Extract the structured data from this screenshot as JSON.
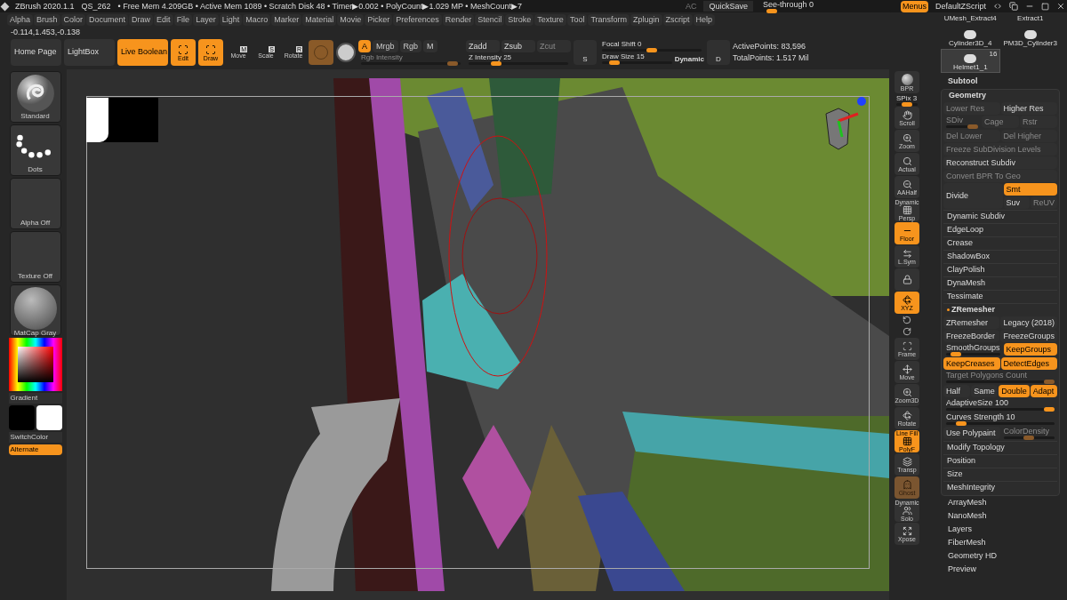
{
  "title_bar": {
    "app": "ZBrush 2020.1.1",
    "project": "QS_262",
    "status": "• Free Mem 4.209GB • Active Mem 1089 • Scratch Disk 48 • Timer▶0.002 • PolyCount▶1.029 MP • MeshCount▶7",
    "ac": "AC",
    "quicksave": "QuickSave",
    "see_through": {
      "label": "See-through  0",
      "level": 0.03
    },
    "menus": {
      "label": "Menus",
      "on": true
    },
    "script": "DefaultZScript"
  },
  "menu_bar": [
    "Alpha",
    "Brush",
    "Color",
    "Document",
    "Draw",
    "Edit",
    "File",
    "Layer",
    "Light",
    "Macro",
    "Marker",
    "Material",
    "Movie",
    "Picker",
    "Preferences",
    "Render",
    "Stencil",
    "Stroke",
    "Texture",
    "Tool",
    "Transform",
    "Zplugin",
    "Zscript",
    "Help"
  ],
  "coordinates": "-0.114,1.453,-0.138",
  "toolbar": {
    "buttons": [
      {
        "label": "Home Page",
        "on": false
      },
      {
        "label": "LightBox",
        "on": false
      },
      {
        "label": "Live Boolean",
        "on": true
      }
    ],
    "transform_modes": [
      {
        "label": "Edit",
        "on": true
      },
      {
        "label": "Draw",
        "on": true
      },
      {
        "label": "Move",
        "key": "M",
        "on": false
      },
      {
        "label": "Scale",
        "key": "S",
        "on": false
      },
      {
        "label": "Rotate",
        "key": "R",
        "on": false
      }
    ],
    "color_modes": [
      {
        "label": "A",
        "on": true
      },
      {
        "label": "Mrgb",
        "on": false
      },
      {
        "label": "Rgb",
        "on": false
      },
      {
        "label": "M",
        "on": false
      }
    ],
    "rgb_intensity": {
      "label": "Rgb Intensity",
      "level": 0.97,
      "disabled": true
    },
    "depth_modes": [
      {
        "label": "Zadd",
        "on": false,
        "disabled": false
      },
      {
        "label": "Zsub",
        "on": false,
        "disabled": false
      },
      {
        "label": "Zcut",
        "on": false,
        "disabled": true
      }
    ],
    "z_intensity": {
      "label": "Z Intensity 25",
      "level": 0.25
    },
    "focal_key": "S",
    "focal_shift": {
      "label": "Focal Shift 0",
      "level": 0.5
    },
    "draw_size": {
      "label": "Draw Size 15",
      "level": 0.12
    },
    "dynamic": "Dynamic",
    "points_key": "D",
    "active_points": "ActivePoints: 83,596",
    "total_points": "TotalPoints: 1.517 Mil"
  },
  "tools": [
    {
      "label": "UMesh_Extract4",
      "selected": false
    },
    {
      "label": "Extract1",
      "selected": false
    },
    {
      "label": "Cylinder3D_4",
      "selected": false
    },
    {
      "label": "PM3D_Cylinder3",
      "selected": false
    },
    {
      "label": "Helmet1_1",
      "count": "16",
      "selected": true
    }
  ],
  "left_shelf": {
    "tiles": [
      "Standard",
      "Dots",
      "Alpha Off",
      "Texture Off",
      "MatCap Gray"
    ],
    "gradient": "Gradient",
    "swatches": [
      {
        "color": "#000000"
      },
      {
        "color": "#ffffff"
      }
    ],
    "switch_color": "SwitchColor",
    "alternate": {
      "label": "Alternate",
      "on": true
    }
  },
  "right_toolbar": [
    {
      "kind": "button",
      "label": "BPR",
      "on": false,
      "disabled": false
    },
    {
      "kind": "slider",
      "label": "SPix 3",
      "level": 0.5
    },
    {
      "kind": "button",
      "label": "Scroll",
      "on": false,
      "disabled": false
    },
    {
      "kind": "button",
      "label": "Zoom",
      "on": false,
      "disabled": false
    },
    {
      "kind": "button",
      "label": "Actual",
      "on": false,
      "disabled": false
    },
    {
      "kind": "button",
      "label": "AAHalf",
      "on": false,
      "disabled": false
    },
    {
      "kind": "button",
      "caption": "Dynamic",
      "label": "Persp",
      "on": false,
      "disabled": false
    },
    {
      "kind": "button",
      "label": "Floor",
      "on": true,
      "disabled": false
    },
    {
      "kind": "button",
      "label": "L.Sym",
      "on": false,
      "disabled": false
    },
    {
      "kind": "button",
      "on": false,
      "disabled": false
    },
    {
      "kind": "button",
      "label": "XYZ",
      "on": true,
      "disabled": false
    },
    {
      "kind": "icon"
    },
    {
      "kind": "icon"
    },
    {
      "kind": "button",
      "label": "Frame",
      "on": false,
      "disabled": false
    },
    {
      "kind": "button",
      "label": "Move",
      "on": false,
      "disabled": false
    },
    {
      "kind": "button",
      "label": "Zoom3D",
      "on": false,
      "disabled": false
    },
    {
      "kind": "button",
      "label": "Rotate",
      "on": false,
      "disabled": false
    },
    {
      "kind": "button",
      "caption": "Line Fill",
      "label": "PolyF",
      "on": true,
      "disabled": false
    },
    {
      "kind": "button",
      "label": "Transp",
      "on": false,
      "disabled": false
    },
    {
      "kind": "button",
      "label": "Ghost",
      "on": true,
      "disabled": true
    },
    {
      "kind": "button",
      "caption": "Dynamic",
      "label": "Solo",
      "on": false,
      "disabled": false
    },
    {
      "kind": "button",
      "label": "Xpose",
      "on": false,
      "disabled": false
    }
  ],
  "subtool": "Subtool",
  "geometry": {
    "title": "Geometry",
    "entries": [
      {
        "kind": "row",
        "controls": [
          {
            "kind": "button",
            "label": "Lower Res",
            "on": false,
            "disabled": true
          },
          {
            "kind": "button",
            "label": "Higher Res",
            "on": false,
            "disabled": false
          }
        ]
      },
      {
        "kind": "row",
        "controls": [
          {
            "kind": "slider",
            "label": "SDiv",
            "level": 1,
            "disabled": true
          },
          {
            "kind": "button",
            "label": "Cage",
            "on": false,
            "disabled": true
          },
          {
            "kind": "button",
            "label": "Rstr",
            "on": false,
            "disabled": true
          }
        ]
      },
      {
        "kind": "row",
        "controls": [
          {
            "kind": "button",
            "label": "Del Lower",
            "on": false,
            "disabled": true
          },
          {
            "kind": "button",
            "label": "Del Higher",
            "on": false,
            "disabled": true
          }
        ]
      },
      {
        "kind": "row",
        "controls": [
          {
            "kind": "button",
            "label": "Freeze SubDivision Levels",
            "on": false,
            "disabled": true
          }
        ]
      },
      {
        "kind": "row",
        "controls": [
          {
            "kind": "button",
            "label": "Reconstruct Subdiv",
            "on": false,
            "disabled": false
          }
        ]
      },
      {
        "kind": "row",
        "controls": [
          {
            "kind": "button",
            "label": "Convert BPR To Geo",
            "on": false,
            "disabled": true
          }
        ]
      },
      {
        "kind": "split",
        "controls": [
          {
            "kind": "button",
            "label": "Divide",
            "on": false,
            "disabled": false
          },
          {
            "kind": "button",
            "label": "Smt",
            "on": true,
            "disabled": false
          },
          {
            "kind": "button",
            "label": "Suv",
            "on": false,
            "disabled": false
          },
          {
            "kind": "button",
            "label": "ReUV",
            "on": false,
            "disabled": true
          }
        ]
      },
      {
        "kind": "item",
        "label": "Dynamic Subdiv",
        "expanded": false
      },
      {
        "kind": "item",
        "label": "EdgeLoop",
        "expanded": false
      },
      {
        "kind": "item",
        "label": "Crease",
        "expanded": false
      },
      {
        "kind": "item",
        "label": "ShadowBox",
        "expanded": false
      },
      {
        "kind": "item",
        "label": "ClayPolish",
        "expanded": false
      },
      {
        "kind": "item",
        "label": "DynaMesh",
        "expanded": false
      },
      {
        "kind": "item",
        "label": "Tessimate",
        "expanded": false
      },
      {
        "kind": "item",
        "label": "ZRemesher",
        "expanded": true,
        "rows": [
          {
            "controls": [
              {
                "kind": "button",
                "label": "ZRemesher",
                "on": false,
                "disabled": false
              },
              {
                "kind": "button",
                "label": "Legacy (2018)",
                "on": false,
                "disabled": false
              }
            ]
          },
          {
            "controls": [
              {
                "kind": "button",
                "label": "FreezeBorder",
                "on": false,
                "disabled": false
              },
              {
                "kind": "button",
                "label": "FreezeGroups",
                "on": false,
                "disabled": false
              }
            ]
          },
          {
            "controls": [
              {
                "kind": "slider",
                "label": "SmoothGroups",
                "level": 0.1,
                "disabled": false
              },
              {
                "kind": "button",
                "label": "KeepGroups",
                "on": true,
                "disabled": false
              }
            ]
          },
          {
            "controls": [
              {
                "kind": "button",
                "label": "KeepCreases",
                "on": true,
                "disabled": false
              },
              {
                "kind": "button",
                "label": "DetectEdges",
                "on": true,
                "disabled": false
              }
            ]
          },
          {
            "controls": [
              {
                "kind": "slider",
                "label": "Target Polygons Count",
                "level": 1,
                "disabled": true
              }
            ]
          },
          {
            "controls": [
              {
                "kind": "button",
                "label": "Half",
                "on": false,
                "disabled": false
              },
              {
                "kind": "button",
                "label": "Same",
                "on": false,
                "disabled": false
              },
              {
                "kind": "button",
                "label": "Double",
                "on": true,
                "disabled": false
              },
              {
                "kind": "button",
                "label": "Adapt",
                "on": true,
                "disabled": false
              }
            ]
          },
          {
            "controls": [
              {
                "kind": "slider",
                "label": "AdaptiveSize 100",
                "level": 1,
                "disabled": false
              }
            ]
          },
          {
            "controls": [
              {
                "kind": "slider",
                "label": "Curves Strength 10",
                "level": 0.1,
                "disabled": false
              }
            ]
          },
          {
            "controls": [
              {
                "kind": "button",
                "label": "Use Polypaint",
                "on": false,
                "disabled": false
              },
              {
                "kind": "slider",
                "label": "ColorDensity",
                "level": 0.5,
                "disabled": true
              }
            ]
          }
        ]
      },
      {
        "kind": "item",
        "label": "Modify Topology",
        "expanded": false
      },
      {
        "kind": "item",
        "label": "Position",
        "expanded": false
      },
      {
        "kind": "item",
        "label": "Size",
        "expanded": false
      },
      {
        "kind": "item",
        "label": "MeshIntegrity",
        "expanded": false
      }
    ]
  },
  "palettes": [
    "ArrayMesh",
    "NanoMesh",
    "Layers",
    "FiberMesh",
    "Geometry HD",
    "Preview"
  ]
}
